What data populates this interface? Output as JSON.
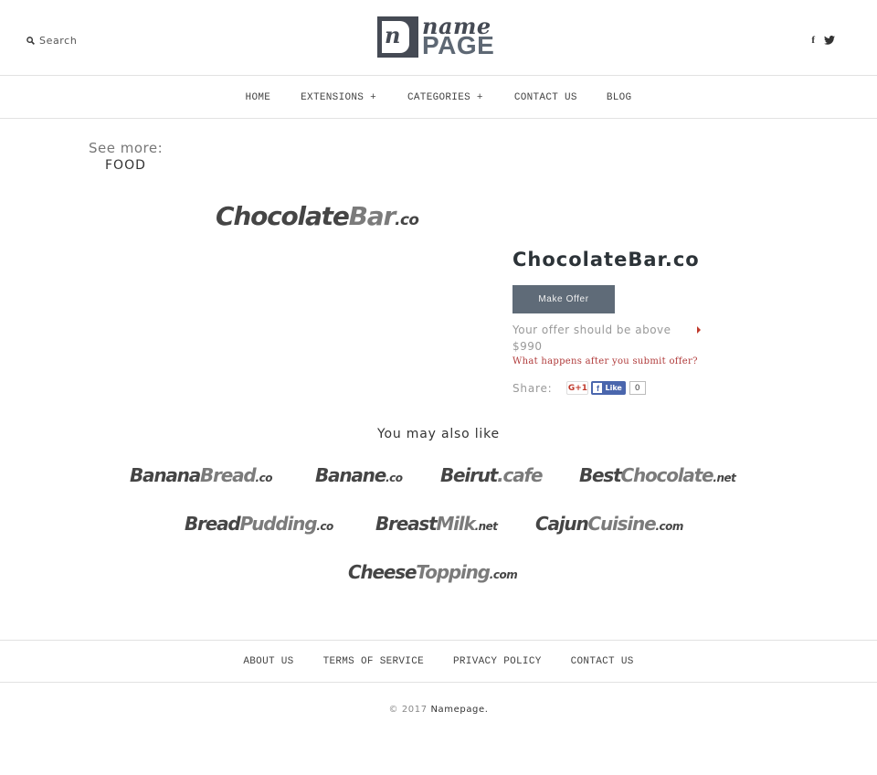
{
  "header": {
    "search_label": "Search",
    "logo": {
      "script": "name",
      "word": "PAGE",
      "mark": "n"
    },
    "social": {
      "facebook": "f"
    }
  },
  "nav": {
    "items": [
      {
        "label": "HOME"
      },
      {
        "label": "EXTENSIONS +"
      },
      {
        "label": "CATEGORIES +"
      },
      {
        "label": "CONTACT US"
      },
      {
        "label": "BLOG"
      }
    ]
  },
  "sidebar": {
    "see_more_label": "See more:",
    "category": "FOOD"
  },
  "product": {
    "logo": {
      "part1": "Chocolate",
      "part2": "Bar",
      "tld": ".co"
    },
    "title": "ChocolateBar.co",
    "offer_button": "Make Offer",
    "offer_note": "Your offer should be above $990",
    "offer_link": "What happens after you submit offer?",
    "share_label": "Share:",
    "gplus_label": "G+1",
    "fb_like_label": "Like",
    "fb_like_count": "0"
  },
  "also_like": {
    "heading": "You may also like",
    "items": [
      {
        "part1": "Banana",
        "part2": "Bread",
        "tld": ".co"
      },
      {
        "part1": "Banane",
        "part2": "",
        "tld": ".co"
      },
      {
        "part1": "Beirut",
        "part2": "",
        "tld": ".cafe"
      },
      {
        "part1": "Best",
        "part2": "Chocolate",
        "tld": ".net"
      },
      {
        "part1": "Bread",
        "part2": "Pudding",
        "tld": ".co"
      },
      {
        "part1": "Breast",
        "part2": "Milk",
        "tld": ".net"
      },
      {
        "part1": "Cajun",
        "part2": "Cuisine",
        "tld": ".com"
      },
      {
        "part1": "Cheese",
        "part2": "Topping",
        "tld": ".com"
      }
    ]
  },
  "footer": {
    "links": [
      {
        "label": "ABOUT US"
      },
      {
        "label": "TERMS OF SERVICE"
      },
      {
        "label": "PRIVACY POLICY"
      },
      {
        "label": "CONTACT US"
      }
    ],
    "copyright": "© 2017",
    "brand": "Namepage."
  },
  "colors": {
    "button": "#5f6b78",
    "link_red": "#b03a3a",
    "logo_dark": "#454a54",
    "facebook": "#4a66ad"
  }
}
